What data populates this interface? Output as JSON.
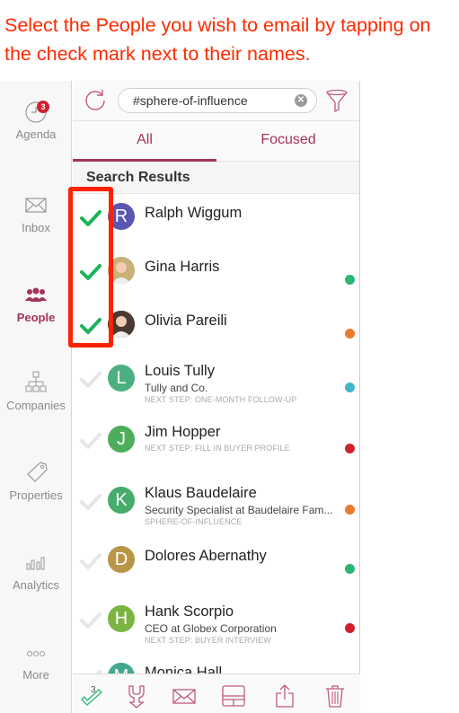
{
  "instruction": "Select the People you wish to email by tapping on the check mark next to their names.",
  "sidebar": {
    "items": [
      {
        "label": "Agenda",
        "icon": "clock-icon",
        "badge": "3",
        "active": false
      },
      {
        "label": "Inbox",
        "icon": "envelope-icon",
        "active": false
      },
      {
        "label": "People",
        "icon": "people-icon",
        "active": true
      },
      {
        "label": "Companies",
        "icon": "org-chart-icon",
        "active": false
      },
      {
        "label": "Properties",
        "icon": "tag-icon",
        "active": false
      },
      {
        "label": "Analytics",
        "icon": "bar-chart-icon",
        "active": false
      },
      {
        "label": "More",
        "icon": "more-dots-icon",
        "active": false
      }
    ]
  },
  "search": {
    "value": "#sphere-of-influence",
    "clear_icon": "✕"
  },
  "tabs": {
    "all": "All",
    "focused": "Focused"
  },
  "section_title": "Search Results",
  "colors": {
    "accent": "#a43455",
    "check_selected": "#1db35a",
    "check_unselected": "#e6e6e6",
    "highlight": "#ff2200"
  },
  "people": [
    {
      "name": "Ralph Wiggum",
      "initial": "R",
      "avatar_color": "#5a56b3",
      "selected": true,
      "subtitle": "",
      "step": "",
      "dot": ""
    },
    {
      "name": "Gina Harris",
      "initial": "",
      "avatar_color": "#c8b27a",
      "photo": true,
      "selected": true,
      "subtitle": "",
      "step": "",
      "dot": "#2bb673"
    },
    {
      "name": "Olivia Pareili",
      "initial": "",
      "avatar_color": "#4a3a33",
      "photo": true,
      "selected": true,
      "subtitle": "",
      "step": "",
      "dot": "#ec7a2e"
    },
    {
      "name": "Louis Tully",
      "initial": "L",
      "avatar_color": "#4caf7f",
      "selected": false,
      "subtitle": "Tully and Co.",
      "step": "NEXT STEP: ONE-MONTH FOLLOW-UP",
      "dot": "#3fb8c8"
    },
    {
      "name": "Jim Hopper",
      "initial": "J",
      "avatar_color": "#4cae5b",
      "selected": false,
      "subtitle": "",
      "step": "NEXT STEP: FILL IN BUYER PROFILE",
      "dot": "#d0202e"
    },
    {
      "name": "Klaus Baudelaire",
      "initial": "K",
      "avatar_color": "#46ac6c",
      "selected": false,
      "subtitle": "Security Specialist at Baudelaire Fam...",
      "step": "SPHERE-OF-INFLUENCE",
      "dot": "#ec7a2e"
    },
    {
      "name": "Dolores Abernathy",
      "initial": "D",
      "avatar_color": "#b99548",
      "selected": false,
      "subtitle": "",
      "step": "",
      "dot": "#2bb673"
    },
    {
      "name": "Hank Scorpio",
      "initial": "H",
      "avatar_color": "#7cb342",
      "selected": false,
      "subtitle": "CEO at Globex Corporation",
      "step": "NEXT STEP: BUYER INTERVIEW",
      "dot": "#d0202e"
    },
    {
      "name": "Monica Hall",
      "initial": "M",
      "avatar_color": "#43a88e",
      "selected": false,
      "subtitle": "",
      "step": "",
      "dot": "#ec7a2e"
    }
  ],
  "bottom_bar": {
    "selected_count": "3",
    "actions": [
      "select-all-icon",
      "merge-icon",
      "email-icon",
      "layout-icon",
      "share-icon",
      "trash-icon"
    ]
  }
}
